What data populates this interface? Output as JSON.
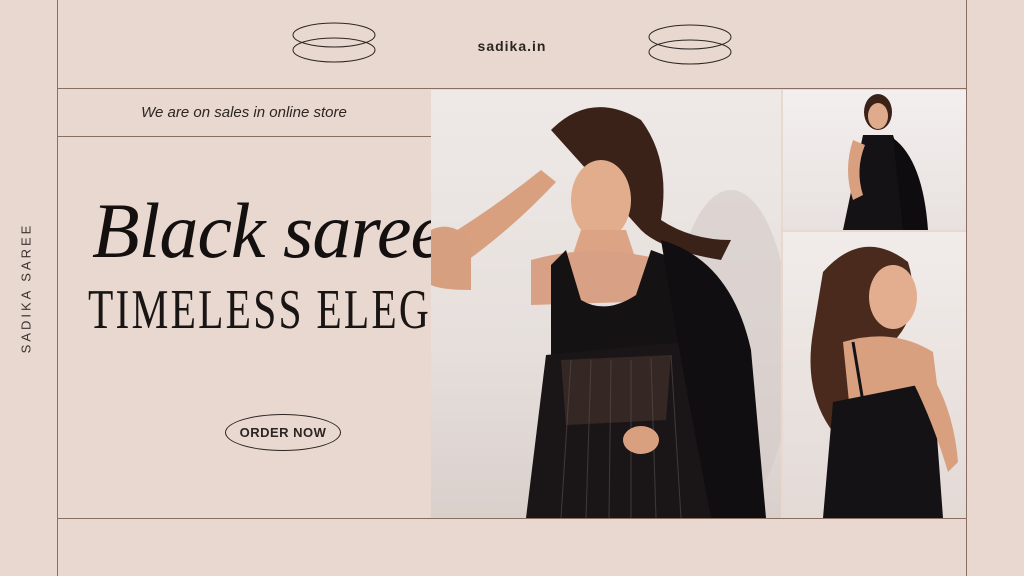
{
  "brand": {
    "name": "sadika.in"
  },
  "side_label": "SADIKA SAREE",
  "banner": {
    "sales_text": "We are on sales in online store",
    "script_title": "Black saree",
    "subtitle": "TIMELESS ELEGANCE",
    "cta_label": "ORDER NOW"
  },
  "colors": {
    "background": "#e9d8cf",
    "lines": "#8a6e62",
    "text": "#2b2523",
    "saree": "#141214"
  },
  "photos": [
    {
      "name": "main-model-photo",
      "description": "woman in black sequined saree"
    },
    {
      "name": "top-right-model-photo",
      "description": "woman in black saree standing"
    },
    {
      "name": "bottom-right-model-photo",
      "description": "woman in black saree back view"
    }
  ]
}
